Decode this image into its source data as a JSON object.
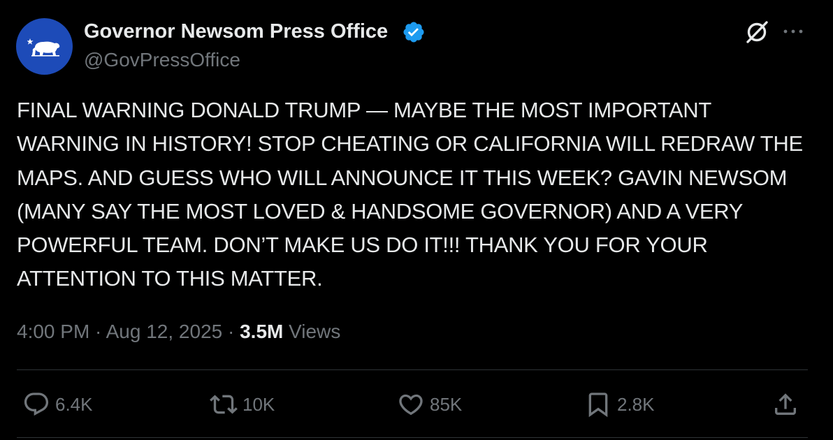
{
  "author": {
    "display_name": "Governor Newsom Press Office",
    "handle": "@GovPressOffice",
    "verified": true,
    "avatar_icon": "california-bear-icon",
    "avatar_color": "#1d4bb8"
  },
  "header_actions": {
    "grok_icon": "grok-icon",
    "more_icon": "more-icon"
  },
  "tweet": {
    "text": "FINAL WARNING DONALD TRUMP — MAYBE THE MOST IMPORTANT WARNING IN HISTORY! STOP CHEATING OR CALIFORNIA WILL REDRAW THE MAPS. AND GUESS WHO WILL ANNOUNCE IT THIS WEEK? GAVIN NEWSOM (MANY SAY THE MOST LOVED & HANDSOME GOVERNOR) AND A VERY POWERFUL TEAM. DON’T MAKE US DO IT!!! THANK YOU FOR YOUR ATTENTION TO THIS MATTER."
  },
  "meta": {
    "time": "4:00 PM",
    "separator": " · ",
    "date": "Aug 12, 2025",
    "views_count": "3.5M",
    "views_label": " Views"
  },
  "actions": {
    "replies": "6.4K",
    "reposts": "10K",
    "likes": "85K",
    "bookmarks": "2.8K"
  },
  "colors": {
    "background": "#000000",
    "text_primary": "#e7e9ea",
    "text_secondary": "#71767b",
    "verified_blue": "#1d9bf0",
    "divider": "#2f3336"
  }
}
